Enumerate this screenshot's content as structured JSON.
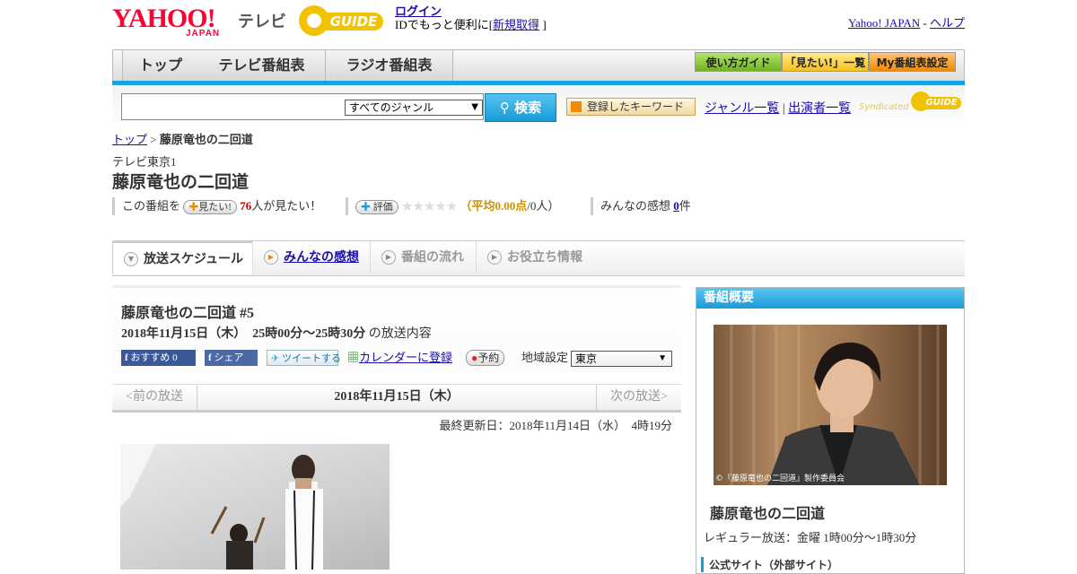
{
  "header": {
    "yahoo": "YAHOO!",
    "japan": "JAPAN",
    "tv": "テレビ",
    "gguide_word": "GUIDE",
    "login": "ログイン",
    "login_sub_prefix": "IDでもっと便利に[",
    "login_sub_link": "新規取得",
    "login_sub_suffix": "]",
    "yahoo_japan_link": "Yahoo! JAPAN",
    "separator": "-",
    "help_link": "ヘルプ"
  },
  "nav": {
    "tabs": [
      "トップ",
      "テレビ番組表",
      "ラジオ番組表"
    ],
    "buttons": [
      "使い方ガイド",
      "「見たい!」一覧",
      "My番組表設定"
    ]
  },
  "search": {
    "genre_selected": "すべてのジャンル",
    "button": "検索",
    "keyword_button": "登録したキーワード",
    "genre_list": "ジャンル一覧",
    "divider": "|",
    "cast_list": "出演者一覧",
    "syndicated": "Syndicated",
    "syndicated_word": "GUIDE"
  },
  "breadcrumb": {
    "top": "トップ",
    "sep": ">",
    "current": "藤原竜也の二回道"
  },
  "program": {
    "channel": "テレビ東京1",
    "title": "藤原竜也の二回道",
    "stats": {
      "this_program": "この番組を",
      "want_pill": "見たい!",
      "want_count": "76",
      "want_suffix": "人が見たい！",
      "rate_pill": "評価",
      "stars": "★★★★★",
      "rating_open": "（",
      "rating_label": "平均",
      "rating_value": "0.00点",
      "rating_people": "/0人）",
      "impressions_label": "みんなの感想",
      "impressions_count": "0",
      "impressions_suffix": "件"
    }
  },
  "subtabs": [
    "放送スケジュール",
    "みんなの感想",
    "番組の流れ",
    "お役立ち情報"
  ],
  "episode": {
    "title": "藤原竜也の二回道 #5",
    "date": "2018年11月15日（木）　25時00分～25時30分",
    "date_suffix": "の放送内容",
    "recommend_label": "おすすめ",
    "recommend_count": "0",
    "share": "シェア",
    "tweet": "ツイートする",
    "calendar": "カレンダーに登録",
    "reserve": "予約",
    "region_label": "地域設定",
    "region_value": "東京"
  },
  "datenav": {
    "prev": "<前の放送",
    "current": "2018年11月15日（木）",
    "next": "次の放送>"
  },
  "updated": "最終更新日：2018年11月14日（水）　4時19分",
  "overview": {
    "header": "番組概要",
    "photo_caption": "©『藤原竜也の二回道』製作委員会",
    "title": "藤原竜也の二回道",
    "regular": "レギュラー放送：金曜 1時00分～1時30分",
    "official": "公式サイト（外部サイト）"
  },
  "colors": {
    "accent_blue": "#1aa3df",
    "yahoo_red": "#ff0033",
    "gguide_yellow": "#f2c200",
    "want_red": "#cc0000"
  }
}
